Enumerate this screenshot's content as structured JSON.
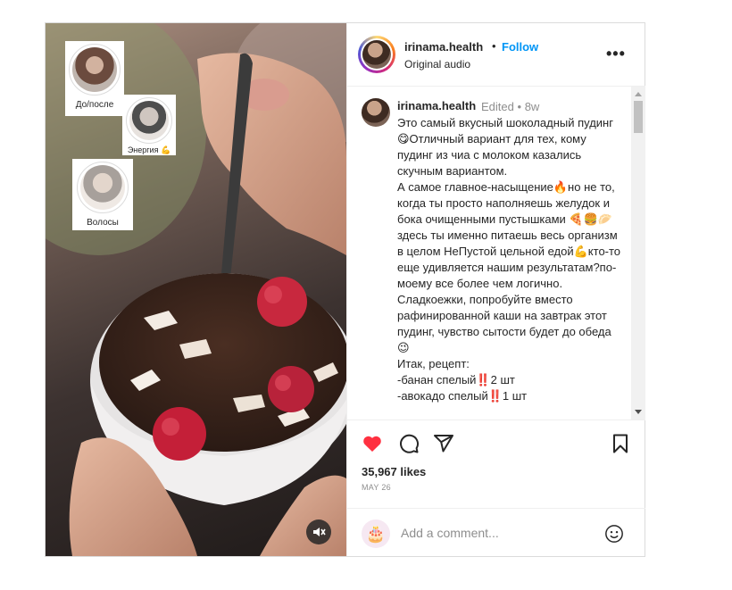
{
  "post": {
    "username": "irinama.health",
    "follow_label": "Follow",
    "separator": "•",
    "audio_label": "Original audio",
    "more_label": "•••"
  },
  "highlights": [
    {
      "label": "До/после"
    },
    {
      "label": "Энергия 💪"
    },
    {
      "label": "Волосы"
    }
  ],
  "caption": {
    "username": "irinama.health",
    "edited_label": "Edited",
    "separator": "•",
    "age": "8w",
    "text": "Это самый вкусный шоколадный пудинг😋Отличный вариант для тех, кому пудинг из чиа с молоком казались скучным вариантом.\nА самое главное-насыщение🔥но не то, когда ты просто наполняешь желудок и бока очищенными пустышками 🍕🍔🥟здесь ты именно питаешь весь организм в целом НеПустой цельной едой💪кто-то еще удивляется нашим результатам?по-моему все более чем логично.\nСладкоежки, попробуйте вместо рафинированной каши на завтрак этот пудинг, чувство сытости будет до обеда 😉\nИтак, рецепт:\n-банан спелый‼️2 шт\n-авокадо спелый‼️1 шт"
  },
  "actions": {
    "likes": "35,967 likes",
    "date": "MAY 26",
    "comment_placeholder": "Add a comment..."
  },
  "colors": {
    "like_red": "#ff3040",
    "follow_blue": "#0095f6",
    "muted_text": "#8e8e8e"
  }
}
